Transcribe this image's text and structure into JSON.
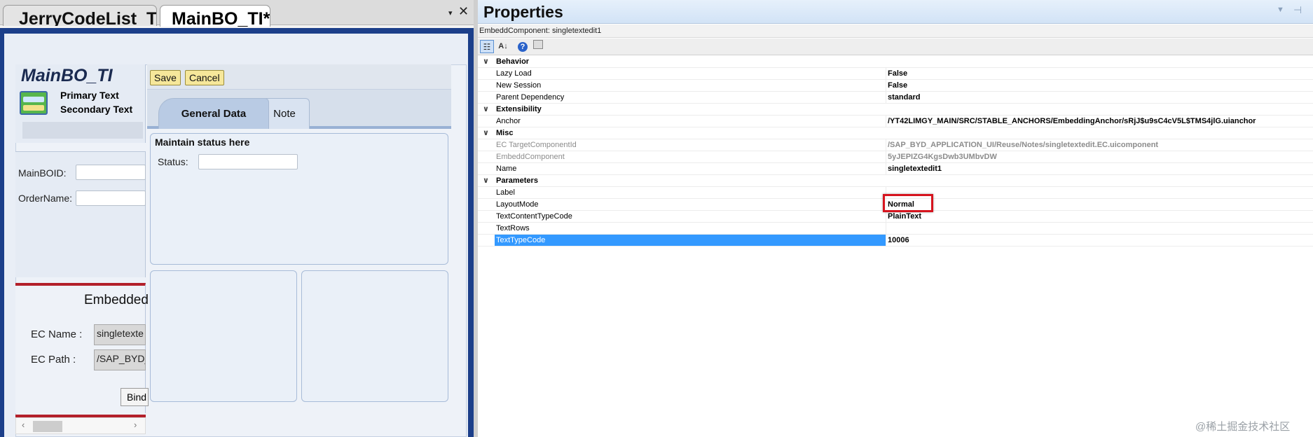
{
  "doc_tabs": [
    {
      "label": "JerryCodeList_TI"
    },
    {
      "label": "MainBO_TI*"
    }
  ],
  "tab_controls": {
    "dropdown": "▾",
    "close": "✕"
  },
  "form": {
    "title": "MainBO_TI",
    "primary_text": "Primary Text",
    "secondary_text": "Secondary Text",
    "fields": {
      "mainboid_label": "MainBOID:",
      "ordername_label": "OrderName:"
    },
    "embed": {
      "title": "Embedded",
      "ec_name_label": "EC Name :",
      "ec_name_value": "singletexte",
      "ec_path_label": "EC Path :",
      "ec_path_value": "/SAP_BYD_",
      "bind_label": "Bind"
    },
    "toolbar": {
      "save_label": "Save",
      "cancel_label": "Cancel"
    },
    "tabs": [
      {
        "label": "General Data"
      },
      {
        "label": "Note"
      }
    ],
    "status_section": {
      "title": "Maintain status here",
      "status_label": "Status:"
    }
  },
  "properties": {
    "title": "Properties",
    "object_label": "EmbeddComponent: singletextedit1",
    "toolbar_icons": [
      "categorized-icon",
      "alphabetical-icon",
      "help-icon",
      "property-pages-icon"
    ],
    "categories": {
      "behavior": {
        "name": "Behavior",
        "rows": [
          {
            "name": "Lazy Load",
            "value": "False"
          },
          {
            "name": "New Session",
            "value": "False"
          },
          {
            "name": "Parent Dependency",
            "value": "standard"
          }
        ]
      },
      "extensibility": {
        "name": "Extensibility",
        "rows": [
          {
            "name": "Anchor",
            "value": "/YT42LIMGY_MAIN/SRC/STABLE_ANCHORS/EmbeddingAnchor/sRjJ$u9sC4cV5L$TMS4jlG.uianchor"
          }
        ]
      },
      "misc": {
        "name": "Misc",
        "rows": [
          {
            "name": "EC TargetComponentId",
            "value": "/SAP_BYD_APPLICATION_UI/Reuse/Notes/singletextedit.EC.uicomponent"
          },
          {
            "name": "EmbeddComponent",
            "value": "5yJEPIZG4KgsDwb3UMbvDW"
          },
          {
            "name": "Name",
            "value": "singletextedit1"
          }
        ]
      },
      "parameters": {
        "name": "Parameters",
        "rows": [
          {
            "name": "Label",
            "value": ""
          },
          {
            "name": "LayoutMode",
            "value": "Normal"
          },
          {
            "name": "TextContentTypeCode",
            "value": "PlainText"
          },
          {
            "name": "TextRows",
            "value": ""
          },
          {
            "name": "TextTypeCode",
            "value": "10006"
          }
        ]
      }
    }
  },
  "watermark": "@稀土掘金技术社区",
  "colors": {
    "selection": "#3399ff",
    "highlight": "#d6141e",
    "frame_blue": "#1c3f8a",
    "button_yellow": "#f6e79a"
  }
}
